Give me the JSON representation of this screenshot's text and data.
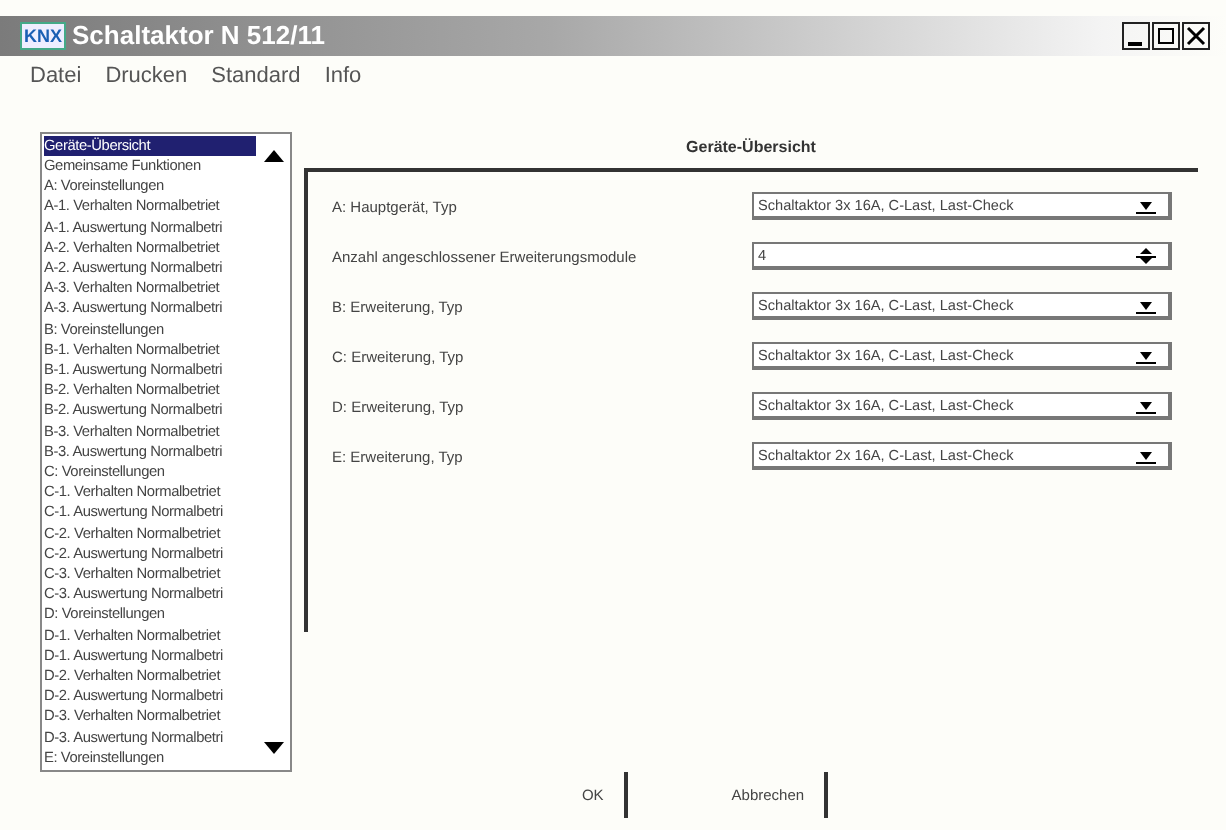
{
  "window": {
    "title": "Schaltaktor N 512/11",
    "logo": "KNX"
  },
  "menu": [
    "Datei",
    "Drucken",
    "Standard",
    "Info"
  ],
  "sidebar": {
    "items": [
      {
        "label": "Geräte-Übersicht",
        "selected": true
      },
      {
        "label": "Gemeinsame Funktionen",
        "selected": false
      },
      {
        "label": "A: Voreinstellungen",
        "selected": false
      },
      {
        "label": "A-1. Verhalten Normalbetriet",
        "selected": false
      },
      {
        "label": "A-1. Auswertung Normalbetri",
        "selected": false
      },
      {
        "label": "A-2. Verhalten Normalbetriet",
        "selected": false
      },
      {
        "label": "A-2. Auswertung Normalbetri",
        "selected": false
      },
      {
        "label": "A-3. Verhalten Normalbetriet",
        "selected": false
      },
      {
        "label": "A-3. Auswertung Normalbetri",
        "selected": false
      },
      {
        "label": "B: Voreinstellungen",
        "selected": false
      },
      {
        "label": "B-1. Verhalten Normalbetriet",
        "selected": false
      },
      {
        "label": "B-1. Auswertung Normalbetri",
        "selected": false
      },
      {
        "label": "B-2. Verhalten Normalbetriet",
        "selected": false
      },
      {
        "label": "B-2. Auswertung Normalbetri",
        "selected": false
      },
      {
        "label": "B-3. Verhalten Normalbetriet",
        "selected": false
      },
      {
        "label": "B-3. Auswertung Normalbetri",
        "selected": false
      },
      {
        "label": "C: Voreinstellungen",
        "selected": false
      },
      {
        "label": "C-1. Verhalten Normalbetriet",
        "selected": false
      },
      {
        "label": "C-1. Auswertung Normalbetri",
        "selected": false
      },
      {
        "label": "C-2. Verhalten Normalbetriet",
        "selected": false
      },
      {
        "label": "C-2. Auswertung Normalbetri",
        "selected": false
      },
      {
        "label": "C-3. Verhalten Normalbetriet",
        "selected": false
      },
      {
        "label": "C-3. Auswertung Normalbetri",
        "selected": false
      },
      {
        "label": "D: Voreinstellungen",
        "selected": false
      },
      {
        "label": "D-1. Verhalten Normalbetriet",
        "selected": false
      },
      {
        "label": "D-1. Auswertung Normalbetri",
        "selected": false
      },
      {
        "label": "D-2. Verhalten Normalbetriet",
        "selected": false
      },
      {
        "label": "D-2. Auswertung Normalbetri",
        "selected": false
      },
      {
        "label": "D-3. Verhalten Normalbetriet",
        "selected": false
      },
      {
        "label": "D-3. Auswertung Normalbetri",
        "selected": false
      },
      {
        "label": "E: Voreinstellungen",
        "selected": false
      }
    ]
  },
  "panel": {
    "title": "Geräte-Übersicht",
    "rows": [
      {
        "kind": "dropdown",
        "label": "A: Hauptgerät, Typ",
        "value": "Schaltaktor 3x 16A, C-Last, Last-Check"
      },
      {
        "kind": "spinner",
        "label": "Anzahl angeschlossener Erweiterungsmodule",
        "value": "4"
      },
      {
        "kind": "dropdown",
        "label": "B: Erweiterung, Typ",
        "value": "Schaltaktor 3x 16A, C-Last, Last-Check"
      },
      {
        "kind": "dropdown",
        "label": "C: Erweiterung, Typ",
        "value": "Schaltaktor 3x 16A, C-Last, Last-Check"
      },
      {
        "kind": "dropdown",
        "label": "D: Erweiterung, Typ",
        "value": "Schaltaktor 3x 16A, C-Last, Last-Check"
      },
      {
        "kind": "dropdown",
        "label": "E: Erweiterung, Typ",
        "value": "Schaltaktor 2x 16A, C-Last, Last-Check"
      }
    ]
  },
  "buttons": [
    "OK",
    "Abbrechen"
  ]
}
